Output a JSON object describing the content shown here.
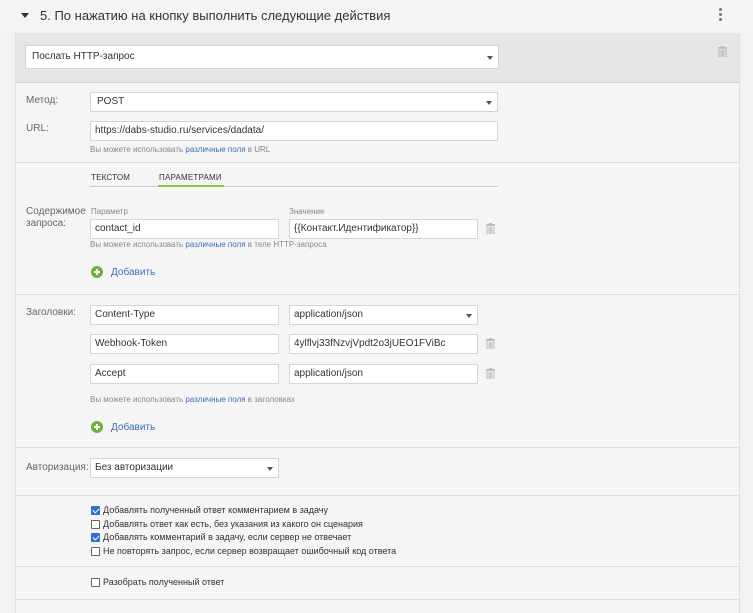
{
  "header": {
    "title": "5. По нажатию на кнопку выполнить следующие действия"
  },
  "action": {
    "selected": "Послать HTTP-запрос"
  },
  "method": {
    "label": "Метод:",
    "value": "POST"
  },
  "url": {
    "label": "URL:",
    "value": "https://dabs-studio.ru/services/dadata/",
    "hint_prefix": "Вы можете использовать",
    "hint_link": "различные поля",
    "hint_suffix": "в URL"
  },
  "body": {
    "label": "Содержимое запроса:",
    "tabs": [
      "ТЕКСТОМ",
      "ПАРАМЕТРАМИ"
    ],
    "param_header": "Параметр",
    "value_header": "Значение",
    "rows": [
      {
        "param": "contact_id",
        "value": "{{Контакт.Идентификатор}}"
      }
    ],
    "hint_prefix": "Вы можете использовать",
    "hint_link": "различные поля",
    "hint_suffix": "в теле HTTP-запроса",
    "add_label": "Добавить"
  },
  "headers": {
    "label": "Заголовки:",
    "rows": [
      {
        "name": "Content-Type",
        "value": "application/json"
      },
      {
        "name": "Webhook-Token",
        "value": "4ylflvj33fNzvjVpdt2o3jUEO1FViBc"
      },
      {
        "name": "Accept",
        "value": "application/json"
      }
    ],
    "hint_prefix": "Вы можете использовать",
    "hint_link": "различные поля",
    "hint_suffix": "в заголовках",
    "add_label": "Добавить"
  },
  "auth": {
    "label": "Авторизация:",
    "value": "Без авторизации"
  },
  "options": [
    {
      "label": "Добавлять полученный ответ комментарием в задачу",
      "checked": true
    },
    {
      "label": "Добавлять ответ как есть, без указания из какого он сценария",
      "checked": false
    },
    {
      "label": "Добавлять комментарий в задачу, если сервер не отвечает",
      "checked": true
    },
    {
      "label": "Не повторять запрос, если сервер возвращает ошибочный код ответа",
      "checked": false
    }
  ],
  "parse": {
    "label": "Разобрать полученный ответ",
    "checked": false
  }
}
